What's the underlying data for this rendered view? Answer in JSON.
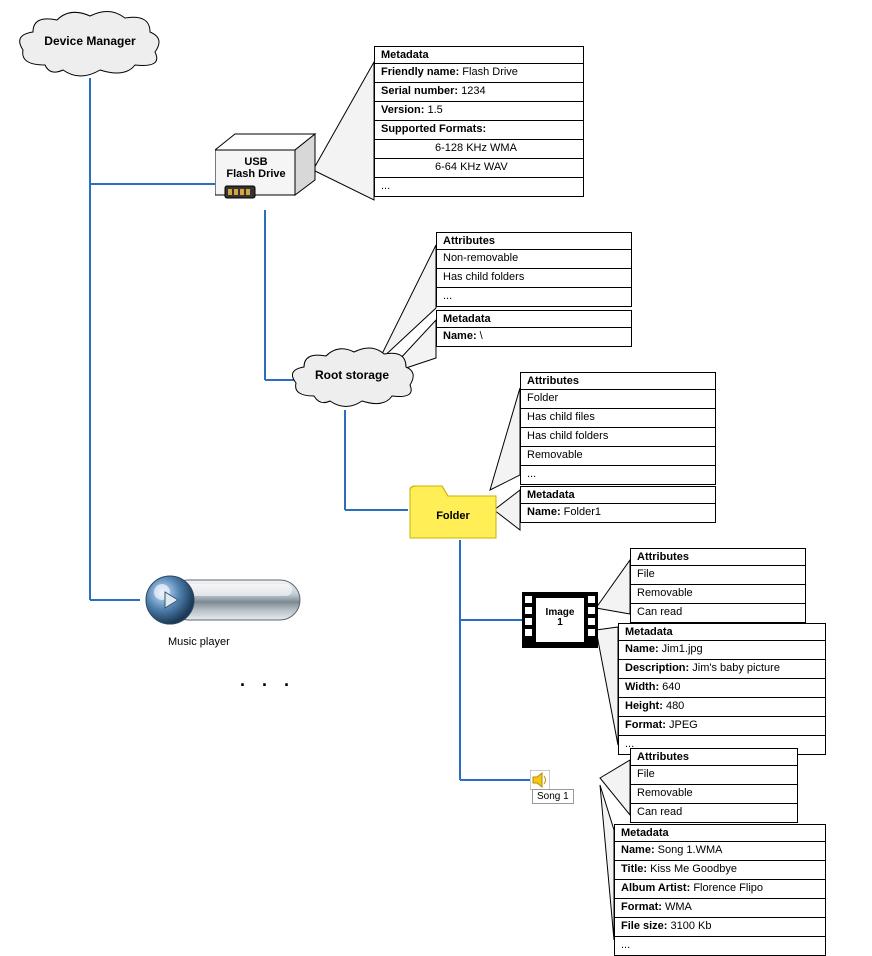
{
  "nodes": {
    "device_manager": "Device Manager",
    "usb": {
      "line1": "USB",
      "line2": "Flash Drive"
    },
    "root_storage": "Root storage",
    "folder": "Folder",
    "image1": {
      "line1": "Image",
      "line2": "1"
    },
    "song1": "Song 1",
    "music_player": "Music player",
    "ellipsis": ". . ."
  },
  "usb_metadata": {
    "header": "Metadata",
    "rows": [
      {
        "k": "Friendly name:",
        "v": " Flash Drive"
      },
      {
        "k": "Serial number:",
        "v": " 1234"
      },
      {
        "k": "Version:",
        "v": " 1.5"
      },
      {
        "k": "Supported Formats:",
        "v": ""
      },
      {
        "k": "",
        "v": "6-128 KHz WMA",
        "indent": true
      },
      {
        "k": "",
        "v": "6-64 KHz WAV",
        "indent": true
      },
      {
        "k": "",
        "v": "..."
      }
    ]
  },
  "root_attributes": {
    "header": "Attributes",
    "rows": [
      "Non-removable",
      "Has child folders",
      "..."
    ]
  },
  "root_metadata": {
    "header": "Metadata",
    "rows": [
      {
        "k": "Name:",
        "v": " \\"
      }
    ]
  },
  "folder_attributes": {
    "header": "Attributes",
    "rows": [
      "Folder",
      "Has child files",
      "Has child folders",
      "Removable",
      "..."
    ]
  },
  "folder_metadata": {
    "header": "Metadata",
    "rows": [
      {
        "k": "Name:",
        "v": " Folder1"
      }
    ]
  },
  "image_attributes": {
    "header": "Attributes",
    "rows": [
      "File",
      "Removable",
      "Can read"
    ]
  },
  "image_metadata": {
    "header": "Metadata",
    "rows": [
      {
        "k": "Name:",
        "v": " Jim1.jpg"
      },
      {
        "k": "Description:",
        "v": " Jim's baby picture"
      },
      {
        "k": "Width:",
        "v": " 640"
      },
      {
        "k": "Height:",
        "v": " 480"
      },
      {
        "k": "Format:",
        "v": " JPEG"
      },
      {
        "k": "",
        "v": "..."
      }
    ]
  },
  "song_attributes": {
    "header": "Attributes",
    "rows": [
      "File",
      "Removable",
      "Can read"
    ]
  },
  "song_metadata": {
    "header": "Metadata",
    "rows": [
      {
        "k": "Name:",
        "v": " Song 1.WMA"
      },
      {
        "k": "Title:",
        "v": " Kiss Me Goodbye"
      },
      {
        "k": "Album Artist:",
        "v": " Florence Flipo"
      },
      {
        "k": "Format:",
        "v": " WMA"
      },
      {
        "k": "File size:",
        "v": " 3100 Kb"
      },
      {
        "k": "",
        "v": "..."
      }
    ]
  }
}
